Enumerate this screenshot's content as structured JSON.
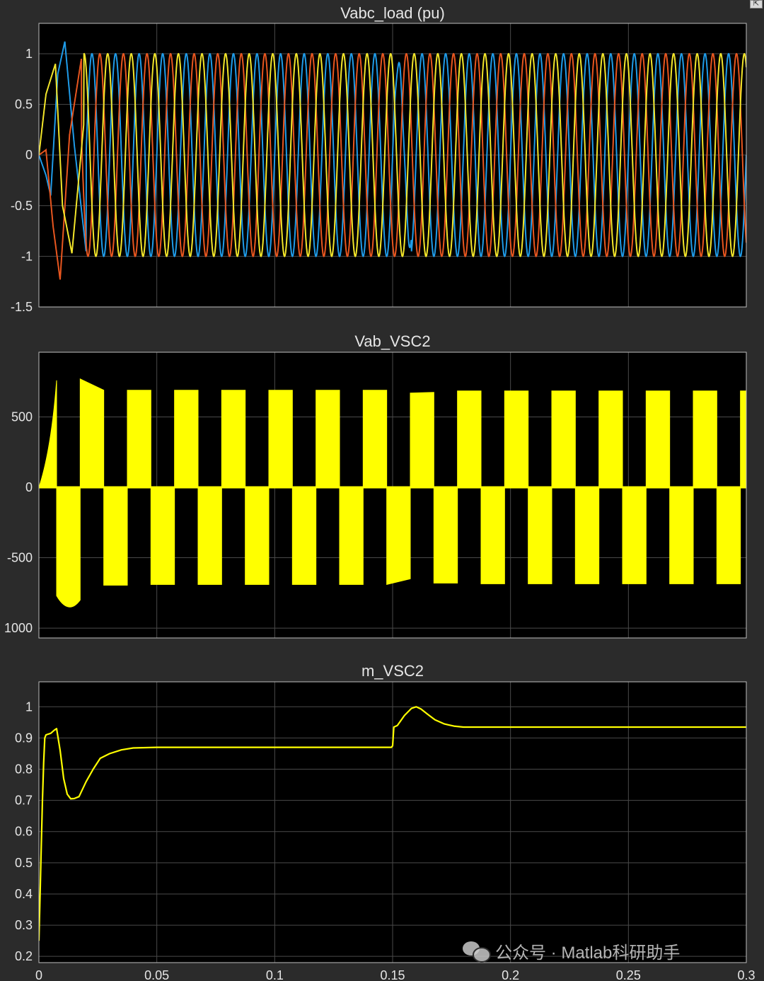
{
  "window": {
    "corner_button_icon": "restore-icon"
  },
  "watermark": {
    "text": "公众号 · Matlab科研助手",
    "icon": "wechat-icon"
  },
  "colors": {
    "background": "#2b2b2b",
    "plot_area": "#000000",
    "grid": "#4a4a4a",
    "text": "#e6e6e6",
    "phase_a": "#1f9be8",
    "phase_b": "#e8561f",
    "phase_c": "#f2e52a",
    "yellow": "#ffff00"
  },
  "chart_data": [
    {
      "type": "line",
      "title": "Vabc_load (pu)",
      "xlabel": "",
      "ylabel": "",
      "xlim": [
        0,
        0.3
      ],
      "ylim": [
        -1.5,
        1.3
      ],
      "xticks": [
        0,
        0.05,
        0.1,
        0.15,
        0.2,
        0.25,
        0.3
      ],
      "yticks": [
        -1.5,
        -1,
        -0.5,
        0,
        0.5,
        1
      ],
      "ytick_labels": [
        "-1.5",
        "-1",
        "-0.5",
        "0",
        "0.5",
        "1"
      ],
      "grid": true,
      "frequency_hz": 100,
      "series": [
        {
          "color": "#1f9be8",
          "phase_deg": 0,
          "transient_points": [
            [
              0,
              0
            ],
            [
              0.003,
              -0.2
            ],
            [
              0.005,
              -0.4
            ],
            [
              0.008,
              0.8
            ],
            [
              0.011,
              1.12
            ],
            [
              0.015,
              0.1
            ],
            [
              0.02,
              -0.95
            ],
            [
              0.15,
              0.8
            ],
            [
              0.152,
              0.55
            ]
          ]
        },
        {
          "color": "#e8561f",
          "phase_deg": -120,
          "transient_points": [
            [
              0,
              0
            ],
            [
              0.003,
              0.05
            ],
            [
              0.006,
              -0.7
            ],
            [
              0.009,
              -1.23
            ],
            [
              0.013,
              0.2
            ],
            [
              0.018,
              0.95
            ]
          ]
        },
        {
          "color": "#f2e52a",
          "phase_deg": 120,
          "transient_points": [
            [
              0,
              0
            ],
            [
              0.003,
              0.6
            ],
            [
              0.007,
              0.9
            ],
            [
              0.01,
              -0.5
            ],
            [
              0.014,
              -0.97
            ],
            [
              0.019,
              0.3
            ]
          ]
        }
      ],
      "steady_amplitude": 1.0
    },
    {
      "type": "area",
      "title": "Vab_VSC2",
      "xlabel": "",
      "ylabel": "",
      "xlim": [
        0,
        0.3
      ],
      "ylim": [
        -1070,
        960
      ],
      "xticks": [
        0,
        0.05,
        0.1,
        0.15,
        0.2,
        0.25,
        0.3
      ],
      "yticks": [
        -1000,
        -500,
        0,
        500
      ],
      "ytick_labels": [
        "1000",
        "-500",
        "0",
        "500"
      ],
      "grid": true,
      "series": [
        {
          "color": "#ffff00",
          "pulses": [
            {
              "t0": 0.0,
              "t1": 0.0075,
              "v_start": 0,
              "v_end": 760
            },
            {
              "t0": 0.0075,
              "t1": 0.0175,
              "v_start": -770,
              "v_mid": -870,
              "v_end": -800
            },
            {
              "t0": 0.0175,
              "t1": 0.0275,
              "v_start": 770,
              "v_end": 690
            },
            {
              "t0": 0.0275,
              "t1": 0.0375,
              "v_start": -695,
              "v_end": -695
            },
            {
              "t0": 0.0375,
              "t1": 0.0475,
              "v_start": 690,
              "v_end": 690
            },
            {
              "t0": 0.0475,
              "t1": 0.0575,
              "v_start": -690,
              "v_end": -690
            },
            {
              "t0": 0.0575,
              "t1": 0.0675,
              "v_start": 690,
              "v_end": 690
            },
            {
              "t0": 0.0675,
              "t1": 0.0775,
              "v_start": -690,
              "v_end": -690
            },
            {
              "t0": 0.0775,
              "t1": 0.0875,
              "v_start": 690,
              "v_end": 690
            },
            {
              "t0": 0.0875,
              "t1": 0.0975,
              "v_start": -690,
              "v_end": -690
            },
            {
              "t0": 0.0975,
              "t1": 0.1075,
              "v_start": 690,
              "v_end": 690
            },
            {
              "t0": 0.1075,
              "t1": 0.1175,
              "v_start": -690,
              "v_end": -690
            },
            {
              "t0": 0.1175,
              "t1": 0.1275,
              "v_start": 690,
              "v_end": 690
            },
            {
              "t0": 0.1275,
              "t1": 0.1375,
              "v_start": -690,
              "v_end": -690
            },
            {
              "t0": 0.1375,
              "t1": 0.1475,
              "v_start": 690,
              "v_end": 690
            },
            {
              "t0": 0.1475,
              "t1": 0.1575,
              "v_start": -690,
              "v_end": -650
            },
            {
              "t0": 0.1575,
              "t1": 0.1675,
              "v_start": 670,
              "v_end": 675
            },
            {
              "t0": 0.1675,
              "t1": 0.1775,
              "v_start": -680,
              "v_end": -680
            },
            {
              "t0": 0.1775,
              "t1": 0.1875,
              "v_start": 685,
              "v_end": 685
            },
            {
              "t0": 0.1875,
              "t1": 0.1975,
              "v_start": -685,
              "v_end": -685
            },
            {
              "t0": 0.1975,
              "t1": 0.2075,
              "v_start": 685,
              "v_end": 685
            },
            {
              "t0": 0.2075,
              "t1": 0.2175,
              "v_start": -685,
              "v_end": -685
            },
            {
              "t0": 0.2175,
              "t1": 0.2275,
              "v_start": 685,
              "v_end": 685
            },
            {
              "t0": 0.2275,
              "t1": 0.2375,
              "v_start": -685,
              "v_end": -685
            },
            {
              "t0": 0.2375,
              "t1": 0.2475,
              "v_start": 685,
              "v_end": 685
            },
            {
              "t0": 0.2475,
              "t1": 0.2575,
              "v_start": -685,
              "v_end": -685
            },
            {
              "t0": 0.2575,
              "t1": 0.2675,
              "v_start": 685,
              "v_end": 685
            },
            {
              "t0": 0.2675,
              "t1": 0.2775,
              "v_start": -685,
              "v_end": -685
            },
            {
              "t0": 0.2775,
              "t1": 0.2875,
              "v_start": 685,
              "v_end": 685
            },
            {
              "t0": 0.2875,
              "t1": 0.2975,
              "v_start": -685,
              "v_end": -685
            },
            {
              "t0": 0.2975,
              "t1": 0.3,
              "v_start": 685,
              "v_end": 685
            }
          ]
        }
      ]
    },
    {
      "type": "line",
      "title": "m_VSC2",
      "xlabel": "",
      "ylabel": "",
      "xlim": [
        0,
        0.3
      ],
      "ylim": [
        0.18,
        1.08
      ],
      "xticks": [
        0,
        0.05,
        0.1,
        0.15,
        0.2,
        0.25,
        0.3
      ],
      "xtick_labels": [
        "0",
        "0.05",
        "0.1",
        "0.15",
        "0.2",
        "0.25",
        "0.3"
      ],
      "yticks": [
        0.2,
        0.3,
        0.4,
        0.5,
        0.6,
        0.7,
        0.8,
        0.9,
        1
      ],
      "ytick_labels": [
        "0.2",
        "0.3",
        "0.4",
        "0.5",
        "0.6",
        "0.7",
        "0.8",
        "0.9",
        "1"
      ],
      "grid": true,
      "series": [
        {
          "color": "#ffff00",
          "x": [
            0,
            0.0005,
            0.001,
            0.0015,
            0.002,
            0.0025,
            0.003,
            0.005,
            0.0065,
            0.0075,
            0.009,
            0.0105,
            0.012,
            0.0135,
            0.015,
            0.017,
            0.02,
            0.023,
            0.026,
            0.03,
            0.035,
            0.04,
            0.05,
            0.06,
            0.08,
            0.1,
            0.12,
            0.14,
            0.1495,
            0.15,
            0.1505,
            0.152,
            0.155,
            0.158,
            0.16,
            0.162,
            0.165,
            0.168,
            0.172,
            0.176,
            0.18,
            0.2,
            0.22,
            0.24,
            0.26,
            0.28,
            0.3
          ],
          "y": [
            0.25,
            0.4,
            0.55,
            0.7,
            0.82,
            0.9,
            0.91,
            0.915,
            0.925,
            0.93,
            0.86,
            0.77,
            0.72,
            0.705,
            0.706,
            0.712,
            0.76,
            0.8,
            0.835,
            0.85,
            0.862,
            0.868,
            0.87,
            0.87,
            0.87,
            0.87,
            0.87,
            0.87,
            0.87,
            0.875,
            0.935,
            0.94,
            0.972,
            0.995,
            1.0,
            0.993,
            0.975,
            0.958,
            0.945,
            0.938,
            0.935,
            0.935,
            0.935,
            0.935,
            0.935,
            0.935,
            0.935
          ]
        }
      ]
    }
  ]
}
